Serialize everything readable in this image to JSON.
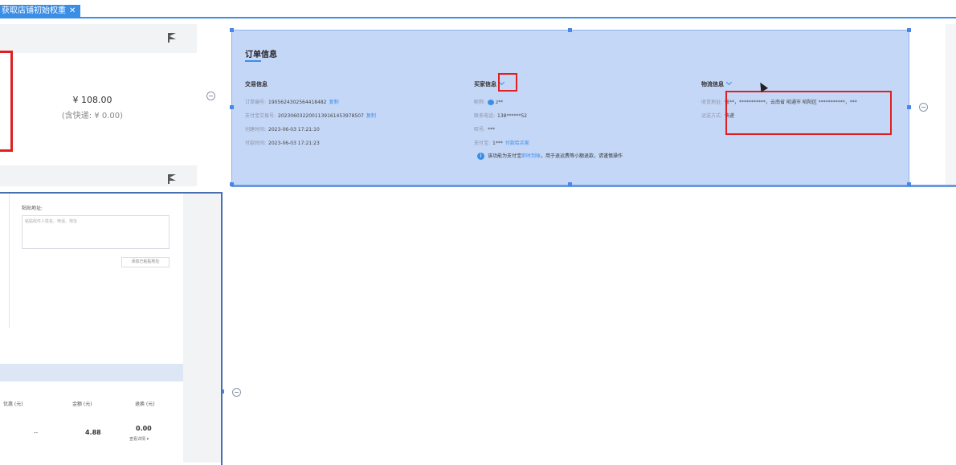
{
  "tab": {
    "label": "获取店铺初始权重",
    "close": "✕"
  },
  "left_panel": {
    "price": "¥ 108.00",
    "price_note": "(含快递: ¥ 0.00)"
  },
  "order": {
    "title": "订单信息",
    "trade": {
      "title": "交易信息",
      "rows": [
        {
          "label": "订单编号:",
          "value": "1905624302564418482",
          "link": "复制"
        },
        {
          "label": "支付宝交易号:",
          "value": "2023060322001139161453978507",
          "link": "复制"
        },
        {
          "label": "创建时间:",
          "value": "2023-06-03 17:21:10"
        },
        {
          "label": "付款时间:",
          "value": "2023-06-03 17:21:23"
        }
      ]
    },
    "buyer": {
      "title": "买家信息",
      "rows": [
        {
          "label": "昵称:",
          "value": "z**"
        },
        {
          "label": "联系电话:",
          "value": "138******52"
        },
        {
          "label": "旺号:",
          "value": "***"
        },
        {
          "label": "支付宝:",
          "value": "1***",
          "link": "付款给买家"
        }
      ],
      "notice_a": "该功能为支付宝",
      "notice_link": "即时到账",
      "notice_b": "，用于退运费等小额退款，请谨慎操作"
    },
    "logistics": {
      "title": "物流信息",
      "rows": [
        {
          "label": "收货地址:",
          "value": "张**，***********，云南省 昭通市 昭阳区 ***********，***"
        },
        {
          "label": "运送方式:",
          "value": "快递"
        }
      ]
    }
  },
  "address_form": {
    "label": "粘贴地址:",
    "placeholder": "粘贴收件人姓名、电话、地址",
    "button": "添加已粘贴地址"
  },
  "table": {
    "headers": [
      "优惠 (元)",
      "金额 (元)",
      "退换 (元)"
    ],
    "row": {
      "discount": "--",
      "amount": "4.88",
      "refund": "0.00",
      "detail": "查看详情 ▾"
    }
  },
  "colors": {
    "accent": "#3a8ee6",
    "selection": "#c5d7f7",
    "highlight": "#e02020"
  }
}
